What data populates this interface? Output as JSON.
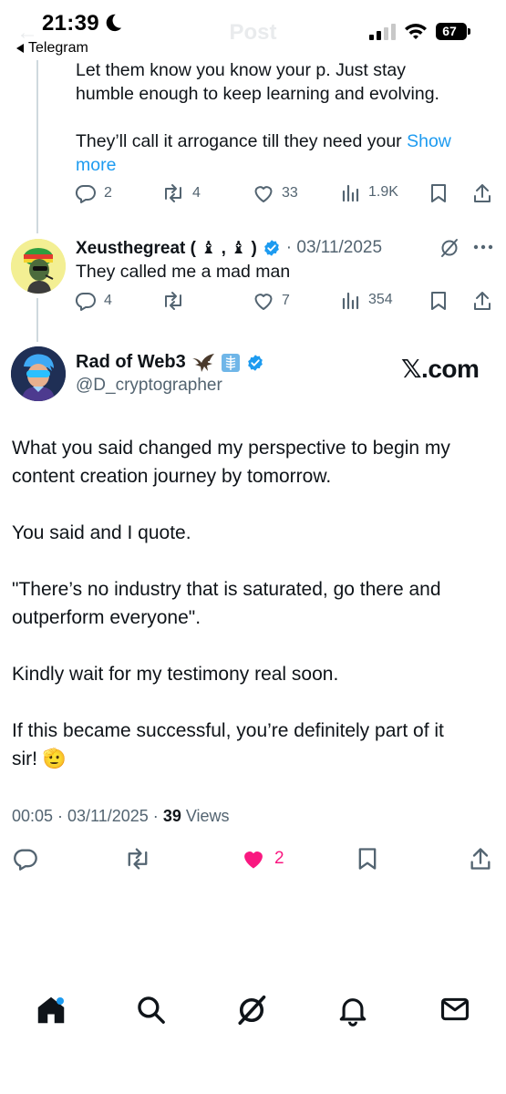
{
  "status_bar": {
    "time": "21:39",
    "back_app": "Telegram",
    "battery": "67",
    "ghost_title": "Post"
  },
  "reply1": {
    "text_line1": "Let them know you know your p. Just stay",
    "text_line2": "humble enough to keep learning and evolving.",
    "text_line3": "They’ll call it arrogance till they need your",
    "show_more_a": "Show",
    "show_more_b": "more",
    "replies": "2",
    "reposts": "4",
    "likes": "33",
    "views": "1.9K"
  },
  "reply2": {
    "name": "Xeusthegreat (",
    "name_mid": ",",
    "name_end": ")",
    "date": "· 03/11/2025",
    "text": "They called me a mad man",
    "replies": "4",
    "likes": "7",
    "views": "354"
  },
  "main_tweet": {
    "name": "Rad of Web3",
    "handle": "@D_cryptographer",
    "watermark": "𝕏.com",
    "p1_line1": "What you said changed my perspective to begin my",
    "p1_line2": "content creation journey by tomorrow.",
    "p2": "You said and I quote.",
    "p3_line1": "\"There’s no industry that is saturated, go there and",
    "p3_line2": "outperform everyone\".",
    "p4": "Kindly wait for my testimony real soon.",
    "p5_line1": "If this became successful, you’re definitely part of it",
    "p5_line2": "sir! 🫡",
    "timestamp": "00:05 · 03/11/2025 ·",
    "views_count": "39",
    "views_label": "Views",
    "likes": "2"
  },
  "colors": {
    "text": "#0f1419",
    "muted": "#536471",
    "link": "#1d9bf0",
    "like": "#f91880",
    "verified": "#1d9bf0"
  },
  "icons": [
    "moon-icon",
    "signal-icon",
    "wifi-icon",
    "reply-icon",
    "repost-icon",
    "heart-icon",
    "views-icon",
    "bookmark-icon",
    "share-icon",
    "grok-icon",
    "more-icon",
    "verified-icon",
    "home-icon",
    "search-icon",
    "notifications-icon",
    "messages-icon"
  ]
}
